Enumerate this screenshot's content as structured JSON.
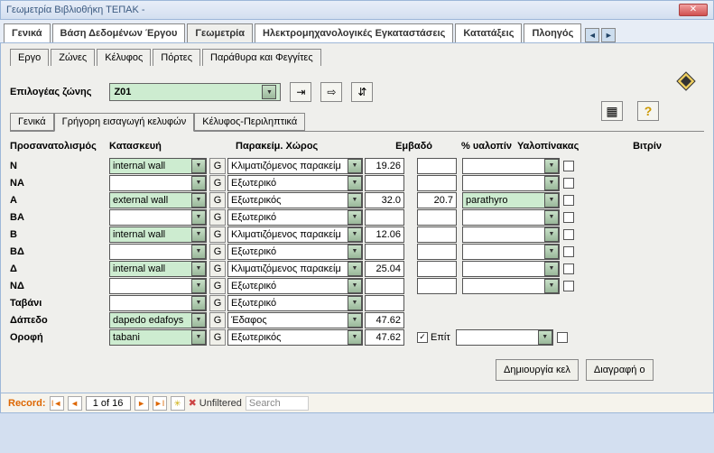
{
  "titlebar": {
    "text": "Γεωμετρία Βιβλιοθήκη ΤΕΠΑΚ -"
  },
  "main_tabs": [
    "Γενικά",
    "Βάση Δεδομένων Έργου",
    "Γεωμετρία",
    "Ηλεκτρομηχανολογικές Εγκαταστάσεις",
    "Κατατάξεις",
    "Πλοηγός"
  ],
  "main_tab_active": 2,
  "sub_tabs": [
    "Εργο",
    "Ζώνες",
    "Κέλυφος",
    "Πόρτες",
    "Παράθυρα και Φεγγίτες"
  ],
  "sub_tab_active": 1,
  "zone": {
    "label": "Επιλογέας ζώνης",
    "value": "Z01"
  },
  "inner_tabs": [
    "Γενικά",
    "Γρήγορη εισαγωγή κελυφών",
    "Κέλυφος-Περιληπτικά"
  ],
  "inner_tab_active": 1,
  "headers": {
    "orient": "Προσανατολισμός",
    "constr": "Κατασκευή",
    "adj": "Παρακείμ. Χώρος",
    "area": "Εμβαδό",
    "glass_pct": "% υαλοπίν",
    "glass_tbl": "Υαλοπίνακας",
    "vitrine": "Βιτρίν"
  },
  "rows": [
    {
      "orient": "Ν",
      "constr": "internal wall",
      "adj": "Κλιματιζόμενος παρακείμ",
      "area": "19.26",
      "glass_pct": "",
      "glass_tbl": ""
    },
    {
      "orient": "ΝΑ",
      "constr": "",
      "adj": "Εξωτερικό",
      "area": "",
      "glass_pct": "",
      "glass_tbl": ""
    },
    {
      "orient": "Α",
      "constr": "external wall",
      "adj": "Εξωτερικός",
      "area": "32.0",
      "glass_pct": "20.7",
      "glass_tbl": "parathyro"
    },
    {
      "orient": "ΒΑ",
      "constr": "",
      "adj": "Εξωτερικό",
      "area": "",
      "glass_pct": "",
      "glass_tbl": ""
    },
    {
      "orient": "Β",
      "constr": "internal wall",
      "adj": "Κλιματιζόμενος παρακείμ",
      "area": "12.06",
      "glass_pct": "",
      "glass_tbl": ""
    },
    {
      "orient": "ΒΔ",
      "constr": "",
      "adj": "Εξωτερικό",
      "area": "",
      "glass_pct": "",
      "glass_tbl": ""
    },
    {
      "orient": "Δ",
      "constr": "internal wall",
      "adj": "Κλιματιζόμενος παρακείμ",
      "area": "25.04",
      "glass_pct": "",
      "glass_tbl": ""
    },
    {
      "orient": "ΝΔ",
      "constr": "",
      "adj": "Εξωτερικό",
      "area": "",
      "glass_pct": "",
      "glass_tbl": ""
    },
    {
      "orient": "Ταβάνι",
      "constr": "",
      "adj": "Εξωτερικό",
      "area": "",
      "glass_pct": null,
      "glass_tbl": null
    },
    {
      "orient": "Δάπεδο",
      "constr": "dapedo edafoys",
      "adj": "Έδαφος",
      "area": "47.62",
      "glass_pct": null,
      "glass_tbl": null
    },
    {
      "orient": "Οροφή",
      "constr": "tabani",
      "adj": "Εξωτερικός",
      "area": "47.62",
      "glass_pct": null,
      "glass_tbl": null,
      "epit": true,
      "epit_label": "Επίτ"
    }
  ],
  "buttons": {
    "create": "Δημιουργία κελ",
    "delete": "Διαγραφή ο"
  },
  "record": {
    "label": "Record:",
    "pos": "1 of 16",
    "filter": "Unfiltered",
    "search": "Search"
  }
}
